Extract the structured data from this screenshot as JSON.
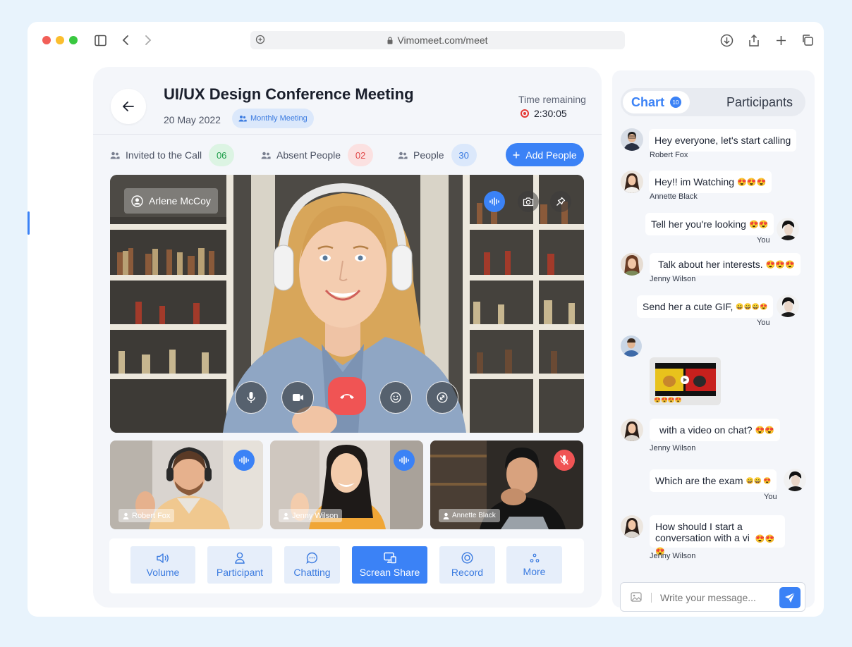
{
  "browser": {
    "url": "Vimomeet.com/meet"
  },
  "meeting": {
    "title": "UI/UX Design Conference Meeting",
    "date": "20 May 2022",
    "tag": "Monthly Meeting",
    "time_remaining_label": "Time remaining",
    "time_remaining": "2:30:05"
  },
  "stats": [
    {
      "label": "Invited to the Call",
      "value": "06",
      "color": "#1e9e4a"
    },
    {
      "label": "Absent People",
      "value": "02",
      "color": "#e04848"
    },
    {
      "label": "People",
      "value": "30",
      "color": "#3b7be0"
    }
  ],
  "add_people_label": "Add People",
  "main_video": {
    "name": "Arlene McCoy"
  },
  "thumbnails": [
    {
      "name": "Robert Fox",
      "mic": "on"
    },
    {
      "name": "Jenny Wilson",
      "mic": "on"
    },
    {
      "name": "Annette Black",
      "mic": "muted"
    }
  ],
  "toolbar": [
    {
      "label": "Volume",
      "icon": "volume-icon"
    },
    {
      "label": "Participant",
      "icon": "user-icon"
    },
    {
      "label": "Chatting",
      "icon": "chat-bubble-icon"
    },
    {
      "label": "Screan Share",
      "icon": "screen-share-icon",
      "active": true
    },
    {
      "label": "Record",
      "icon": "record-icon"
    },
    {
      "label": "More",
      "icon": "more-icon"
    }
  ],
  "chat": {
    "tab_active": "Chart",
    "tab_badge": "10",
    "tab_other": "Participants",
    "messages": [
      {
        "text": "Hey everyone, let's start calling",
        "author": "Robert Fox",
        "side": "left"
      },
      {
        "text": "Hey!! im Watching",
        "emoji": "😍😍😍",
        "author": "Annette Black",
        "side": "left"
      },
      {
        "text": "Tell her you're looking",
        "emoji": "😍😍",
        "author": "You",
        "side": "right"
      },
      {
        "text": "Talk about her interests.",
        "emoji": "😍😍😍",
        "author": "Jenny Wilson",
        "side": "left"
      },
      {
        "text": "Send her a cute GIF,",
        "emoji": "😄😄😄😍",
        "author": "You",
        "side": "right"
      },
      {
        "text": "",
        "author": "",
        "side": "left",
        "gif": true,
        "gif_emoji": "😍😍😍😍"
      },
      {
        "text": "with a video on chat?",
        "emoji": "😍😍",
        "author": "Jenny Wilson",
        "side": "left"
      },
      {
        "text": "Which are the exam",
        "emoji": "😄😄 😍",
        "author": "You",
        "side": "right"
      },
      {
        "text": "How should I start a",
        "text2": "conversation with a vi",
        "emoji": "😍😍😍",
        "author": "Jenny Wilson",
        "side": "left"
      }
    ],
    "input_placeholder": "Write your message..."
  }
}
